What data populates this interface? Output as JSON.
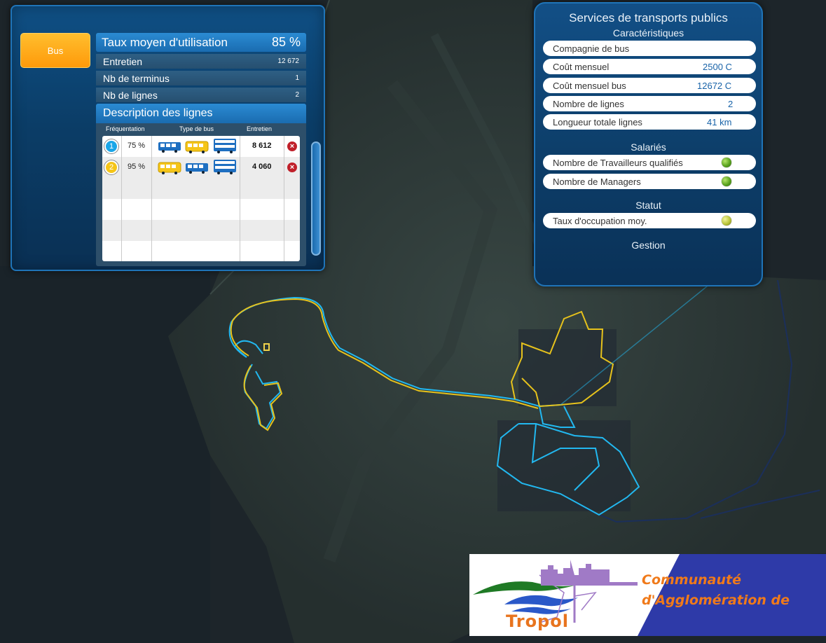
{
  "left_panel": {
    "tab_label": "Bus",
    "avg_usage_label": "Taux moyen d'utilisation",
    "avg_usage_value": "85 %",
    "stats": [
      {
        "label": "Entretien",
        "value": "12 672"
      },
      {
        "label": "Nb de terminus",
        "value": "1"
      },
      {
        "label": "Nb de lignes",
        "value": "2"
      }
    ],
    "lines_title": "Description des lignes",
    "columns": {
      "attendance": "Fréquentation",
      "bus_type": "Type de bus",
      "maintenance": "Entretien"
    },
    "lines": [
      {
        "number": "1",
        "attendance": "75 %",
        "maintenance": "8 612",
        "badge_color": "#1aa6e8",
        "bus_types": [
          "bus-blue-icon",
          "bus-yellow-icon",
          "bus-double-blue-icon"
        ]
      },
      {
        "number": "2",
        "attendance": "95 %",
        "maintenance": "4 060",
        "badge_color": "#f5c518",
        "bus_types": [
          "bus-yellow-icon",
          "bus-blue-icon",
          "bus-double-blue-icon"
        ]
      }
    ]
  },
  "right_panel": {
    "title": "Services de transports publics",
    "sections": {
      "characteristics": "Caractéristiques",
      "employees": "Salariés",
      "status": "Statut",
      "management": "Gestion"
    },
    "fields": [
      {
        "label": "Compagnie de bus",
        "value": ""
      },
      {
        "label": "Coût mensuel",
        "value": "2500 C"
      },
      {
        "label": "Coût mensuel bus",
        "value": "12672 C"
      },
      {
        "label": "Nombre de lignes",
        "value": "2"
      },
      {
        "label": "Longueur totale lignes",
        "value": "41 km"
      }
    ],
    "employees": [
      {
        "label": "Nombre de Travailleurs qualifiés",
        "indicator": "green"
      },
      {
        "label": "Nombre de Managers",
        "indicator": "green"
      }
    ],
    "status": [
      {
        "label": "Taux d'occupation moy.",
        "indicator": "yellow-green"
      }
    ]
  },
  "logo": {
    "name": "Tropol",
    "line1": "Communauté",
    "line2": "d'Agglomération de"
  },
  "colors": {
    "route_line_1": "#22b8f0",
    "route_line_2": "#e6c21c",
    "panel_accent": "#1f74b8",
    "logo_blue": "#2e3aa8",
    "logo_orange": "#f07a1a"
  }
}
